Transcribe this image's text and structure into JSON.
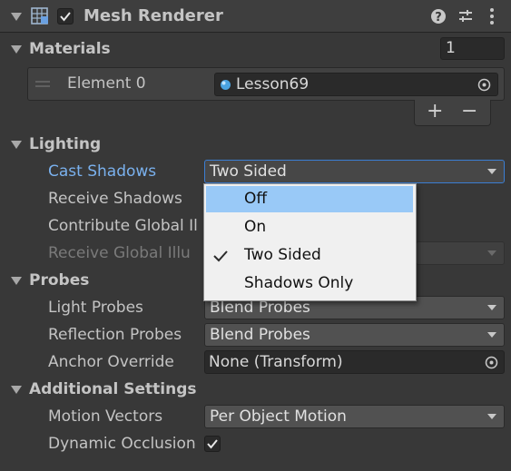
{
  "component": {
    "title": "Mesh Renderer",
    "enabled": true
  },
  "materials": {
    "label": "Materials",
    "count": "1",
    "element_label": "Element 0",
    "element_value": "Lesson69",
    "add": "+",
    "remove": "−"
  },
  "lighting": {
    "label": "Lighting",
    "cast_shadows": {
      "label": "Cast Shadows",
      "value": "Two Sided"
    },
    "receive_shadows": {
      "label": "Receive Shadows"
    },
    "contribute_gi": {
      "label": "Contribute Global Il"
    },
    "receive_gi": {
      "label": "Receive Global Illu"
    }
  },
  "dropdown": {
    "options": [
      "Off",
      "On",
      "Two Sided",
      "Shadows Only"
    ],
    "highlighted": "Off",
    "checked": "Two Sided"
  },
  "probes": {
    "label": "Probes",
    "light_probes": {
      "label": "Light Probes",
      "value": "Blend Probes"
    },
    "reflection_probes": {
      "label": "Reflection Probes",
      "value": "Blend Probes"
    },
    "anchor_override": {
      "label": "Anchor Override",
      "value": "None (Transform)"
    }
  },
  "additional": {
    "label": "Additional Settings",
    "motion_vectors": {
      "label": "Motion Vectors",
      "value": "Per Object Motion"
    },
    "dynamic_occlusion": {
      "label": "Dynamic Occlusion",
      "checked": true
    }
  },
  "icons": [
    "mesh-renderer-icon",
    "help-icon",
    "presets-icon",
    "kebab-menu-icon",
    "object-picker-icon",
    "checkmark-icon",
    "foldout-arrow-icon",
    "material-sphere-icon"
  ],
  "colors": {
    "panel": "#383838",
    "field": "#2a2a2a",
    "dropdown": "#515151",
    "accent": "#3b7ed3",
    "highlight": "#99c9f7",
    "label_highlight": "#7ab1ee"
  }
}
